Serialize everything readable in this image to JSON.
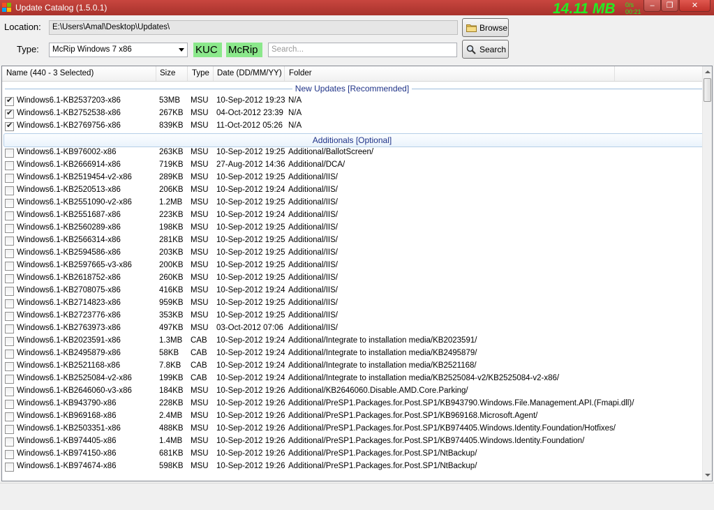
{
  "window": {
    "title": "Update Catalog (1.5.0.1)",
    "speed": "14.11 MB",
    "speed_sub_1": "0/s",
    "speed_sub_2": "00:21",
    "minimize_label": "–",
    "maximize_label": "❐",
    "close_label": "✕"
  },
  "form": {
    "location_label": "Location:",
    "location_value": "E:\\Users\\Amal\\Desktop\\Updates\\",
    "type_label": "Type:",
    "type_value": "McRip Windows 7 x86",
    "tag_kuc": "KUC",
    "tag_mcrip": "McRip",
    "search_placeholder": "Search...",
    "browse_label": "Browse",
    "search_label": "Search"
  },
  "table": {
    "columns": [
      "Name (440 - 3 Selected)",
      "Size",
      "Type",
      "Date (DD/MM/YY)",
      "Folder"
    ],
    "groups": [
      {
        "title": "New Updates [Recommended]",
        "rows": [
          {
            "checked": true,
            "name": "Windows6.1-KB2537203-x86",
            "size": "53MB",
            "type": "MSU",
            "date": "10-Sep-2012 19:23",
            "folder": "N/A"
          },
          {
            "checked": true,
            "name": "Windows6.1-KB2752538-x86",
            "size": "267KB",
            "type": "MSU",
            "date": "04-Oct-2012 23:39",
            "folder": "N/A"
          },
          {
            "checked": true,
            "name": "Windows6.1-KB2769756-x86",
            "size": "839KB",
            "type": "MSU",
            "date": "11-Oct-2012 05:26",
            "folder": "N/A"
          }
        ]
      },
      {
        "title": "Additionals [Optional]",
        "rows": [
          {
            "checked": false,
            "name": "Windows6.1-KB976002-x86",
            "size": "263KB",
            "type": "MSU",
            "date": "10-Sep-2012 19:25",
            "folder": "Additional/BallotScreen/"
          },
          {
            "checked": false,
            "name": "Windows6.1-KB2666914-x86",
            "size": "719KB",
            "type": "MSU",
            "date": "27-Aug-2012 14:36",
            "folder": "Additional/DCA/"
          },
          {
            "checked": false,
            "name": "Windows6.1-KB2519454-v2-x86",
            "size": "289KB",
            "type": "MSU",
            "date": "10-Sep-2012 19:25",
            "folder": "Additional/IIS/"
          },
          {
            "checked": false,
            "name": "Windows6.1-KB2520513-x86",
            "size": "206KB",
            "type": "MSU",
            "date": "10-Sep-2012 19:24",
            "folder": "Additional/IIS/"
          },
          {
            "checked": false,
            "name": "Windows6.1-KB2551090-v2-x86",
            "size": "1.2MB",
            "type": "MSU",
            "date": "10-Sep-2012 19:25",
            "folder": "Additional/IIS/"
          },
          {
            "checked": false,
            "name": "Windows6.1-KB2551687-x86",
            "size": "223KB",
            "type": "MSU",
            "date": "10-Sep-2012 19:24",
            "folder": "Additional/IIS/"
          },
          {
            "checked": false,
            "name": "Windows6.1-KB2560289-x86",
            "size": "198KB",
            "type": "MSU",
            "date": "10-Sep-2012 19:25",
            "folder": "Additional/IIS/"
          },
          {
            "checked": false,
            "name": "Windows6.1-KB2566314-x86",
            "size": "281KB",
            "type": "MSU",
            "date": "10-Sep-2012 19:25",
            "folder": "Additional/IIS/"
          },
          {
            "checked": false,
            "name": "Windows6.1-KB2594586-x86",
            "size": "203KB",
            "type": "MSU",
            "date": "10-Sep-2012 19:25",
            "folder": "Additional/IIS/"
          },
          {
            "checked": false,
            "name": "Windows6.1-KB2597665-v3-x86",
            "size": "200KB",
            "type": "MSU",
            "date": "10-Sep-2012 19:25",
            "folder": "Additional/IIS/"
          },
          {
            "checked": false,
            "name": "Windows6.1-KB2618752-x86",
            "size": "260KB",
            "type": "MSU",
            "date": "10-Sep-2012 19:25",
            "folder": "Additional/IIS/"
          },
          {
            "checked": false,
            "name": "Windows6.1-KB2708075-x86",
            "size": "416KB",
            "type": "MSU",
            "date": "10-Sep-2012 19:24",
            "folder": "Additional/IIS/"
          },
          {
            "checked": false,
            "name": "Windows6.1-KB2714823-x86",
            "size": "959KB",
            "type": "MSU",
            "date": "10-Sep-2012 19:25",
            "folder": "Additional/IIS/"
          },
          {
            "checked": false,
            "name": "Windows6.1-KB2723776-x86",
            "size": "353KB",
            "type": "MSU",
            "date": "10-Sep-2012 19:25",
            "folder": "Additional/IIS/"
          },
          {
            "checked": false,
            "name": "Windows6.1-KB2763973-x86",
            "size": "497KB",
            "type": "MSU",
            "date": "03-Oct-2012 07:06",
            "folder": "Additional/IIS/"
          },
          {
            "checked": false,
            "name": "Windows6.1-KB2023591-x86",
            "size": "1.3MB",
            "type": "CAB",
            "date": "10-Sep-2012 19:24",
            "folder": "Additional/Integrate to installation media/KB2023591/"
          },
          {
            "checked": false,
            "name": "Windows6.1-KB2495879-x86",
            "size": "58KB",
            "type": "CAB",
            "date": "10-Sep-2012 19:24",
            "folder": "Additional/Integrate to installation media/KB2495879/"
          },
          {
            "checked": false,
            "name": "Windows6.1-KB2521168-x86",
            "size": "7.8KB",
            "type": "CAB",
            "date": "10-Sep-2012 19:24",
            "folder": "Additional/Integrate to installation media/KB2521168/"
          },
          {
            "checked": false,
            "name": "Windows6.1-KB2525084-v2-x86",
            "size": "199KB",
            "type": "CAB",
            "date": "10-Sep-2012 19:24",
            "folder": "Additional/Integrate to installation media/KB2525084-v2/KB2525084-v2-x86/"
          },
          {
            "checked": false,
            "name": "Windows6.1-KB2646060-v3-x86",
            "size": "184KB",
            "type": "MSU",
            "date": "10-Sep-2012 19:26",
            "folder": "Additional/KB2646060.Disable.AMD.Core.Parking/"
          },
          {
            "checked": false,
            "name": "Windows6.1-KB943790-x86",
            "size": "228KB",
            "type": "MSU",
            "date": "10-Sep-2012 19:26",
            "folder": "Additional/PreSP1.Packages.for.Post.SP1/KB943790.Windows.File.Management.API.(Fmapi.dll)/"
          },
          {
            "checked": false,
            "name": "Windows6.1-KB969168-x86",
            "size": "2.4MB",
            "type": "MSU",
            "date": "10-Sep-2012 19:26",
            "folder": "Additional/PreSP1.Packages.for.Post.SP1/KB969168.Microsoft.Agent/"
          },
          {
            "checked": false,
            "name": "Windows6.1-KB2503351-x86",
            "size": "488KB",
            "type": "MSU",
            "date": "10-Sep-2012 19:26",
            "folder": "Additional/PreSP1.Packages.for.Post.SP1/KB974405.Windows.Identity.Foundation/Hotfixes/"
          },
          {
            "checked": false,
            "name": "Windows6.1-KB974405-x86",
            "size": "1.4MB",
            "type": "MSU",
            "date": "10-Sep-2012 19:26",
            "folder": "Additional/PreSP1.Packages.for.Post.SP1/KB974405.Windows.Identity.Foundation/"
          },
          {
            "checked": false,
            "name": "Windows6.1-KB974150-x86",
            "size": "681KB",
            "type": "MSU",
            "date": "10-Sep-2012 19:26",
            "folder": "Additional/PreSP1.Packages.for.Post.SP1/NtBackup/"
          },
          {
            "checked": false,
            "name": "Windows6.1-KB974674-x86",
            "size": "598KB",
            "type": "MSU",
            "date": "10-Sep-2012 19:26",
            "folder": "Additional/PreSP1.Packages.for.Post.SP1/NtBackup/"
          }
        ]
      }
    ]
  },
  "colors": {
    "titlebar": "#b8403a",
    "speed_text": "#22ee22",
    "tag_bg": "#8be88b",
    "group_title": "#1e3287"
  },
  "icons": {
    "app": "windows-logo-icon",
    "browse": "folder-icon",
    "search": "magnifier-icon"
  }
}
